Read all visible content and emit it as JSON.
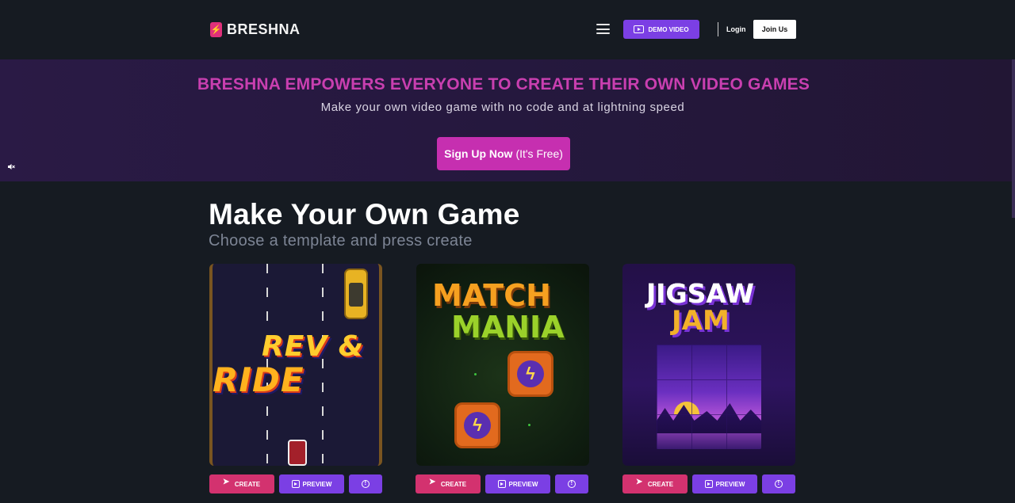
{
  "header": {
    "logo_text": "BRESHNA",
    "logo_mark": "⚡",
    "menu_icon": "hamburger-icon",
    "demo_label": "DEMO VIDEO",
    "login_label": "Login",
    "join_label": "Join Us"
  },
  "hero": {
    "title": "BRESHNA EMPOWERS EVERYONE TO CREATE THEIR OWN VIDEO GAMES",
    "subtitle": "Make your own video game with no code and at lightning speed",
    "signup_bold": "Sign Up Now",
    "signup_free": "(It's Free)",
    "mute_icon": "mute-icon"
  },
  "templates": {
    "title": "Make Your Own Game",
    "subtitle": "Choose a template and press create",
    "cards": [
      {
        "name": "Rev & Ride",
        "logo_line1": "REV &",
        "logo_line2": "RIDE",
        "create_label": "CREATE",
        "preview_label": "PREVIEW"
      },
      {
        "name": "Match Mania",
        "logo_line1": "MATCH",
        "logo_line2": "MANIA",
        "create_label": "CREATE",
        "preview_label": "PREVIEW"
      },
      {
        "name": "Jigsaw Jam",
        "logo_line1": "JIGSAW",
        "logo_line2": "JAM",
        "create_label": "CREATE",
        "preview_label": "PREVIEW"
      }
    ]
  },
  "colors": {
    "accent_purple": "#7b3fe4",
    "accent_pink": "#d3326f",
    "hero_title": "#c93fb0",
    "background": "#161b22"
  }
}
